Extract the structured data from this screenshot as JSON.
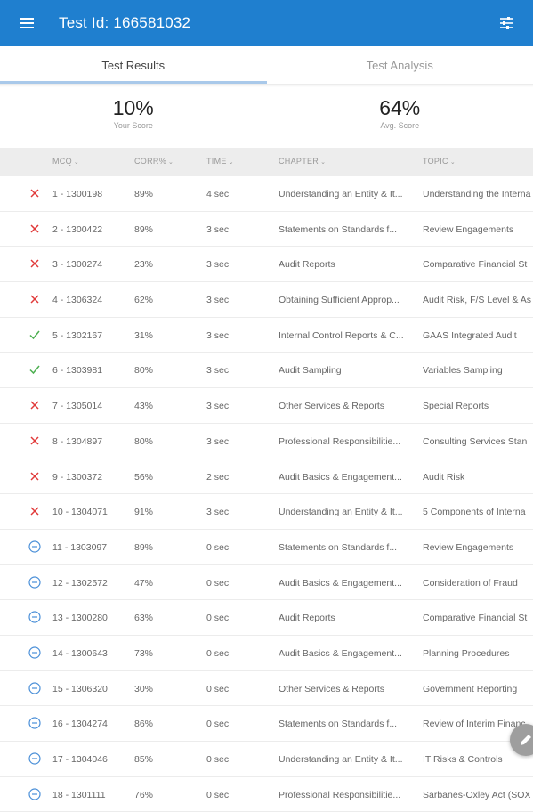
{
  "appbar": {
    "title": "Test Id: 166581032",
    "menu_icon": "menu-icon",
    "filter_icon": "filter-sliders-icon",
    "color": "#1f7fcf"
  },
  "tabs": [
    {
      "label": "Test Results",
      "active": true
    },
    {
      "label": "Test Analysis",
      "active": false
    }
  ],
  "scores": {
    "your_score": {
      "value": "10%",
      "label": "Your Score"
    },
    "avg_score": {
      "value": "64%",
      "label": "Avg. Score"
    }
  },
  "table": {
    "headers": {
      "mcq": "MCQ",
      "corr": "CORR%",
      "time": "TIME",
      "chapter": "CHAPTER",
      "topic": "TOPIC"
    },
    "rows": [
      {
        "status": "incorrect",
        "id": "1 - 1300198",
        "corr": "89%",
        "time": "4 sec",
        "chapter": "Understanding an Entity & It...",
        "topic": "Understanding the Interna"
      },
      {
        "status": "incorrect",
        "id": "2 - 1300422",
        "corr": "89%",
        "time": "3 sec",
        "chapter": "Statements on Standards f...",
        "topic": "Review Engagements"
      },
      {
        "status": "incorrect",
        "id": "3 - 1300274",
        "corr": "23%",
        "time": "3 sec",
        "chapter": "Audit Reports",
        "topic": "Comparative Financial St"
      },
      {
        "status": "incorrect",
        "id": "4 - 1306324",
        "corr": "62%",
        "time": "3 sec",
        "chapter": "Obtaining Sufficient Approp...",
        "topic": "Audit Risk, F/S Level & As"
      },
      {
        "status": "correct",
        "id": "5 - 1302167",
        "corr": "31%",
        "time": "3 sec",
        "chapter": "Internal Control Reports & C...",
        "topic": "GAAS Integrated Audit"
      },
      {
        "status": "correct",
        "id": "6 - 1303981",
        "corr": "80%",
        "time": "3 sec",
        "chapter": "Audit Sampling",
        "topic": "Variables Sampling"
      },
      {
        "status": "incorrect",
        "id": "7 - 1305014",
        "corr": "43%",
        "time": "3 sec",
        "chapter": "Other Services & Reports",
        "topic": "Special Reports"
      },
      {
        "status": "incorrect",
        "id": "8 - 1304897",
        "corr": "80%",
        "time": "3 sec",
        "chapter": "Professional Responsibilitie...",
        "topic": "Consulting Services Stan"
      },
      {
        "status": "incorrect",
        "id": "9 - 1300372",
        "corr": "56%",
        "time": "2 sec",
        "chapter": "Audit Basics & Engagement...",
        "topic": "Audit Risk"
      },
      {
        "status": "incorrect",
        "id": "10 - 1304071",
        "corr": "91%",
        "time": "3 sec",
        "chapter": "Understanding an Entity & It...",
        "topic": "5 Components of Interna"
      },
      {
        "status": "skipped",
        "id": "11 - 1303097",
        "corr": "89%",
        "time": "0 sec",
        "chapter": "Statements on Standards f...",
        "topic": "Review Engagements"
      },
      {
        "status": "skipped",
        "id": "12 - 1302572",
        "corr": "47%",
        "time": "0 sec",
        "chapter": "Audit Basics & Engagement...",
        "topic": "Consideration of Fraud"
      },
      {
        "status": "skipped",
        "id": "13 - 1300280",
        "corr": "63%",
        "time": "0 sec",
        "chapter": "Audit Reports",
        "topic": "Comparative Financial St"
      },
      {
        "status": "skipped",
        "id": "14 - 1300643",
        "corr": "73%",
        "time": "0 sec",
        "chapter": "Audit Basics & Engagement...",
        "topic": "Planning Procedures"
      },
      {
        "status": "skipped",
        "id": "15 - 1306320",
        "corr": "30%",
        "time": "0 sec",
        "chapter": "Other Services & Reports",
        "topic": "Government Reporting"
      },
      {
        "status": "skipped",
        "id": "16 - 1304274",
        "corr": "86%",
        "time": "0 sec",
        "chapter": "Statements on Standards f...",
        "topic": "Review of Interim Financ"
      },
      {
        "status": "skipped",
        "id": "17 - 1304046",
        "corr": "85%",
        "time": "0 sec",
        "chapter": "Understanding an Entity & It...",
        "topic": "IT Risks & Controls"
      },
      {
        "status": "skipped",
        "id": "18 - 1301111",
        "corr": "76%",
        "time": "0 sec",
        "chapter": "Professional Responsibilitie...",
        "topic": "Sarbanes-Oxley Act (SOX"
      }
    ]
  },
  "fab": {
    "icon": "edit-pencil-icon"
  },
  "colors": {
    "incorrect": "#e03a3a",
    "correct": "#4caf50",
    "skipped": "#4a8fd8"
  }
}
